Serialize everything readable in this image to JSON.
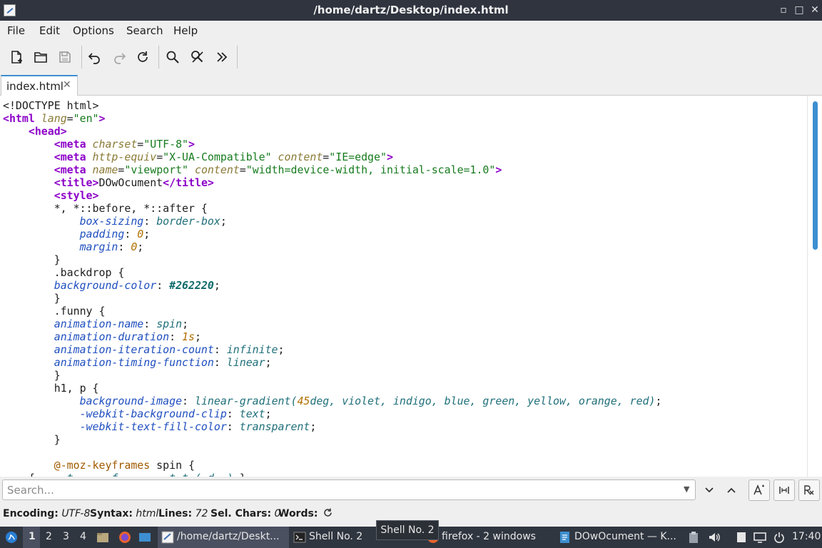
{
  "window": {
    "title": "/home/dartz/Desktop/index.html",
    "minimize": "▫",
    "maximize": "□",
    "close": "✕"
  },
  "menu": [
    "File",
    "Edit",
    "Options",
    "Search",
    "Help"
  ],
  "toolbar": {
    "icons": [
      "new-document-icon",
      "open-folder-icon",
      "save-icon",
      "undo-icon",
      "redo-icon",
      "reload-icon",
      "search-icon",
      "replace-icon",
      "more-icon"
    ]
  },
  "tab": {
    "label": "index.html",
    "close": "✕"
  },
  "code_lines": [
    [
      {
        "t": "<!DOCTYPE html>",
        "c": ""
      }
    ],
    [
      {
        "t": "<html",
        "c": "tg"
      },
      {
        "t": " ",
        "c": ""
      },
      {
        "t": "lang",
        "c": "at"
      },
      {
        "t": "=",
        "c": ""
      },
      {
        "t": "\"en\"",
        "c": "st"
      },
      {
        "t": ">",
        "c": "tg"
      }
    ],
    [
      {
        "t": "    ",
        "c": ""
      },
      {
        "t": "<head>",
        "c": "tg"
      }
    ],
    [
      {
        "t": "        ",
        "c": ""
      },
      {
        "t": "<meta",
        "c": "tg"
      },
      {
        "t": " ",
        "c": ""
      },
      {
        "t": "charset",
        "c": "at"
      },
      {
        "t": "=",
        "c": ""
      },
      {
        "t": "\"UTF-8\"",
        "c": "st"
      },
      {
        "t": ">",
        "c": "tg"
      }
    ],
    [
      {
        "t": "        ",
        "c": ""
      },
      {
        "t": "<meta",
        "c": "tg"
      },
      {
        "t": " ",
        "c": ""
      },
      {
        "t": "http-equiv",
        "c": "at"
      },
      {
        "t": "=",
        "c": ""
      },
      {
        "t": "\"X-UA-Compatible\"",
        "c": "st"
      },
      {
        "t": " ",
        "c": ""
      },
      {
        "t": "content",
        "c": "at"
      },
      {
        "t": "=",
        "c": ""
      },
      {
        "t": "\"IE=edge\"",
        "c": "st"
      },
      {
        "t": ">",
        "c": "tg"
      }
    ],
    [
      {
        "t": "        ",
        "c": ""
      },
      {
        "t": "<meta",
        "c": "tg"
      },
      {
        "t": " ",
        "c": ""
      },
      {
        "t": "name",
        "c": "at"
      },
      {
        "t": "=",
        "c": ""
      },
      {
        "t": "\"viewport\"",
        "c": "st"
      },
      {
        "t": " ",
        "c": ""
      },
      {
        "t": "content",
        "c": "at"
      },
      {
        "t": "=",
        "c": ""
      },
      {
        "t": "\"width=device-width, initial-scale=1.0\"",
        "c": "st"
      },
      {
        "t": ">",
        "c": "tg"
      }
    ],
    [
      {
        "t": "        ",
        "c": ""
      },
      {
        "t": "<title>",
        "c": "tg"
      },
      {
        "t": "DOwOcument",
        "c": ""
      },
      {
        "t": "</title>",
        "c": "tg"
      }
    ],
    [
      {
        "t": "        ",
        "c": ""
      },
      {
        "t": "<style>",
        "c": "tg"
      }
    ],
    [
      {
        "t": "        *, *::before, *::after {",
        "c": ""
      }
    ],
    [
      {
        "t": "            ",
        "c": ""
      },
      {
        "t": "box-sizing",
        "c": "pr"
      },
      {
        "t": ": ",
        "c": ""
      },
      {
        "t": "border-box",
        "c": "vl"
      },
      {
        "t": ";",
        "c": ""
      }
    ],
    [
      {
        "t": "            ",
        "c": ""
      },
      {
        "t": "padding",
        "c": "pr"
      },
      {
        "t": ": ",
        "c": ""
      },
      {
        "t": "0",
        "c": "nm"
      },
      {
        "t": ";",
        "c": ""
      }
    ],
    [
      {
        "t": "            ",
        "c": ""
      },
      {
        "t": "margin",
        "c": "pr"
      },
      {
        "t": ": ",
        "c": ""
      },
      {
        "t": "0",
        "c": "nm"
      },
      {
        "t": ";",
        "c": ""
      }
    ],
    [
      {
        "t": "        }",
        "c": ""
      }
    ],
    [
      {
        "t": "        .backdrop {",
        "c": ""
      }
    ],
    [
      {
        "t": "        ",
        "c": ""
      },
      {
        "t": "background-color",
        "c": "pr"
      },
      {
        "t": ": ",
        "c": ""
      },
      {
        "t": "#262220",
        "c": "hx"
      },
      {
        "t": ";",
        "c": ""
      }
    ],
    [
      {
        "t": "        }",
        "c": ""
      }
    ],
    [
      {
        "t": "        .funny {",
        "c": ""
      }
    ],
    [
      {
        "t": "        ",
        "c": ""
      },
      {
        "t": "animation-name",
        "c": "pr"
      },
      {
        "t": ": ",
        "c": ""
      },
      {
        "t": "spin",
        "c": "vl"
      },
      {
        "t": ";",
        "c": ""
      }
    ],
    [
      {
        "t": "        ",
        "c": ""
      },
      {
        "t": "animation-duration",
        "c": "pr"
      },
      {
        "t": ": ",
        "c": ""
      },
      {
        "t": "1s",
        "c": "nm"
      },
      {
        "t": ";",
        "c": ""
      }
    ],
    [
      {
        "t": "        ",
        "c": ""
      },
      {
        "t": "animation-iteration-count",
        "c": "pr"
      },
      {
        "t": ": ",
        "c": ""
      },
      {
        "t": "infinite",
        "c": "vl"
      },
      {
        "t": ";",
        "c": ""
      }
    ],
    [
      {
        "t": "        ",
        "c": ""
      },
      {
        "t": "animation-timing-function",
        "c": "pr"
      },
      {
        "t": ": ",
        "c": ""
      },
      {
        "t": "linear",
        "c": "vl"
      },
      {
        "t": ";",
        "c": ""
      }
    ],
    [
      {
        "t": "        }",
        "c": ""
      }
    ],
    [
      {
        "t": "        h1, p {",
        "c": ""
      }
    ],
    [
      {
        "t": "            ",
        "c": ""
      },
      {
        "t": "background-image",
        "c": "pr"
      },
      {
        "t": ": ",
        "c": ""
      },
      {
        "t": "linear-gradient(",
        "c": "vl"
      },
      {
        "t": "45",
        "c": "nm"
      },
      {
        "t": "deg, violet, indigo, blue, green, yellow, orange, red)",
        "c": "vl"
      },
      {
        "t": ";",
        "c": ""
      }
    ],
    [
      {
        "t": "            ",
        "c": ""
      },
      {
        "t": "-webkit-background-clip",
        "c": "pr"
      },
      {
        "t": ": ",
        "c": ""
      },
      {
        "t": "text",
        "c": "vl"
      },
      {
        "t": ";",
        "c": ""
      }
    ],
    [
      {
        "t": "            ",
        "c": ""
      },
      {
        "t": "-webkit-text-fill-color",
        "c": "pr"
      },
      {
        "t": ": ",
        "c": ""
      },
      {
        "t": "transparent",
        "c": "vl"
      },
      {
        "t": ";",
        "c": ""
      }
    ],
    [
      {
        "t": "        }",
        "c": ""
      }
    ],
    [
      {
        "t": "",
        "c": ""
      }
    ],
    [
      {
        "t": "        ",
        "c": ""
      },
      {
        "t": "@-moz-keyframes",
        "c": "kw"
      },
      {
        "t": " spin {",
        "c": ""
      }
    ],
    [
      {
        "t": "    {     ",
        "c": ""
      },
      {
        "t": "t      f        t t ( d  )",
        "c": "vl"
      },
      {
        "t": " }",
        "c": ""
      }
    ]
  ],
  "search": {
    "placeholder": "Search..."
  },
  "status": {
    "encoding_key": "Encoding:",
    "encoding_val": "UTF-8",
    "syntax_key": "Syntax:",
    "syntax_val": "html",
    "lines_key": "Lines:",
    "lines_val": "72",
    "sel_key": "Sel. Chars:",
    "sel_val": "0",
    "words_key": "Words:"
  },
  "taskbar": {
    "workspaces": [
      "1",
      "2",
      "3",
      "4"
    ],
    "tasks": [
      "/home/dartz/Deskt...",
      "Shell No. 2",
      "firefox - 2 windows",
      "DOwOcument — K..."
    ],
    "tooltip": "Shell No. 2",
    "clock": "17:40"
  }
}
